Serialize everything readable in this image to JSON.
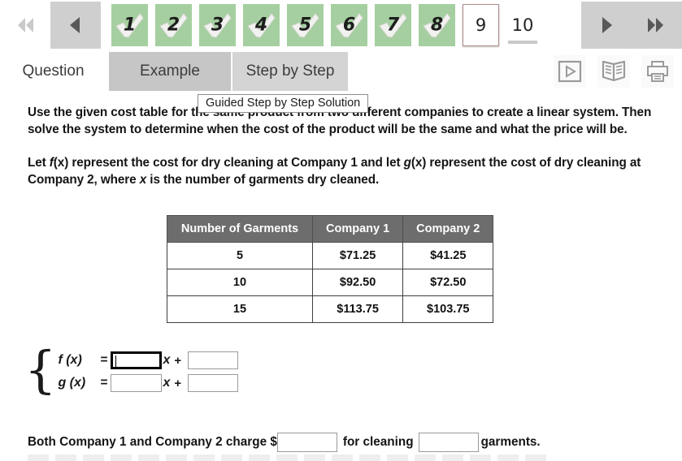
{
  "pager": {
    "first_label": "first-page",
    "prev_label": "previous-page",
    "next_label": "next-page",
    "last_label": "last-page",
    "current_page": "9",
    "total_pages": "10",
    "completed_pages": [
      "1",
      "2",
      "3",
      "4",
      "5",
      "6",
      "7",
      "8"
    ],
    "last_page_label": "10"
  },
  "tabs": [
    {
      "label": "Question"
    },
    {
      "label": "Example"
    },
    {
      "label": "Step by Step"
    }
  ],
  "tooltip": {
    "text": "Guided Step by Step Solution"
  },
  "toolbar": {
    "video_icon": "play-video-icon",
    "book_icon": "open-book-icon",
    "print_icon": "printer-icon"
  },
  "question": {
    "paragraph1": "Use the given cost table for the same product from two different companies to create a linear system. Then solve the system to determine when the cost of the product will be the same and what the price will be.",
    "paragraph2_pre": "Let ",
    "paragraph2_f": "f",
    "paragraph2_fx": "(x)",
    "paragraph2_mid": " represent the cost for dry cleaning at Company 1 and let ",
    "paragraph2_g": "g",
    "paragraph2_gx": "(x)",
    "paragraph2_mid2": " represent the cost of dry cleaning at Company 2, where ",
    "paragraph2_x": "x",
    "paragraph2_end": " is the number of garments dry cleaned."
  },
  "table": {
    "headers": [
      "Number of Garments",
      "Company 1",
      "Company 2"
    ],
    "rows": [
      [
        "5",
        "$71.25",
        "$41.25"
      ],
      [
        "10",
        "$92.50",
        "$72.50"
      ],
      [
        "15",
        "$113.75",
        "$103.75"
      ]
    ]
  },
  "system": {
    "brace": "{",
    "row1": {
      "label": "f (x)",
      "equals": "=",
      "slope_value": "",
      "x": "x",
      "plus": "+",
      "intercept_value": ""
    },
    "row2": {
      "label": "g (x)",
      "equals": "=",
      "slope_value": "",
      "x": "x",
      "plus": "+",
      "intercept_value": ""
    }
  },
  "final_answer": {
    "prefix": "Both Company 1 and Company 2 charge $",
    "price_value": "",
    "middle": "for cleaning",
    "garments_value": "",
    "suffix": "garments."
  },
  "colors": {
    "tile_green": "#a5cfa0",
    "current_border": "#b08b8b",
    "nav_button": "#cfcfcf",
    "tab_hover": "#c6c6c6",
    "tab_idle": "#d4d4d4",
    "table_header": "#6d6d6d"
  }
}
